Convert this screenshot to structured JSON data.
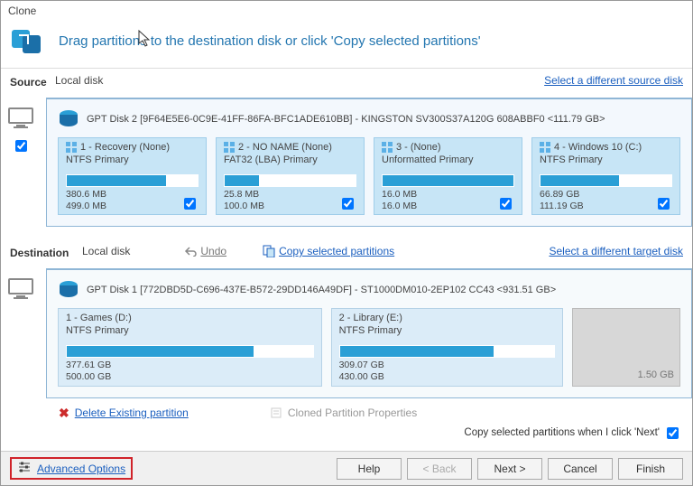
{
  "title": "Clone",
  "header_text": "Drag partitions to the destination disk or click 'Copy selected partitions'",
  "source": {
    "label": "Source",
    "local_disk": "Local disk",
    "select_link": "Select a different source disk",
    "disk_title": "GPT Disk 2 [9F64E5E6-0C9E-41FF-86FA-BFC1ADE610BB] - KINGSTON SV300S37A120G 608ABBF0  <111.79 GB>",
    "partitions": [
      {
        "name": "1 - Recovery (None)",
        "fs": "NTFS Primary",
        "used": "380.6 MB",
        "total": "499.0 MB",
        "fill": 76
      },
      {
        "name": "2 - NO NAME (None)",
        "fs": "FAT32 (LBA) Primary",
        "used": "25.8 MB",
        "total": "100.0 MB",
        "fill": 26
      },
      {
        "name": "3 -  (None)",
        "fs": "Unformatted Primary",
        "used": "16.0 MB",
        "total": "16.0 MB",
        "fill": 100
      },
      {
        "name": "4 - Windows 10 (C:)",
        "fs": "NTFS Primary",
        "used": "66.89 GB",
        "total": "111.19 GB",
        "fill": 60
      }
    ]
  },
  "destination": {
    "label": "Destination",
    "local_disk": "Local disk",
    "undo": "Undo",
    "copy_selected": "Copy selected partitions",
    "select_link": "Select a different target disk",
    "disk_title": "GPT Disk 1 [772DBD5D-C696-437E-B572-29DD146A49DF] - ST1000DM010-2EP102 CC43  <931.51 GB>",
    "partitions": [
      {
        "name": "1 - Games (D:)",
        "fs": "NTFS Primary",
        "used": "377.61 GB",
        "total": "500.00 GB",
        "fill": 76
      },
      {
        "name": "2 - Library (E:)",
        "fs": "NTFS Primary",
        "used": "309.07 GB",
        "total": "430.00 GB",
        "fill": 72
      }
    ],
    "free_label": "1.50 GB",
    "delete_existing": "Delete Existing partition",
    "cloned_props": "Cloned Partition Properties"
  },
  "hint": "Copy selected partitions when I click 'Next'",
  "footer": {
    "advanced": "Advanced Options",
    "help": "Help",
    "back": "< Back",
    "next": "Next >",
    "cancel": "Cancel",
    "finish": "Finish"
  }
}
